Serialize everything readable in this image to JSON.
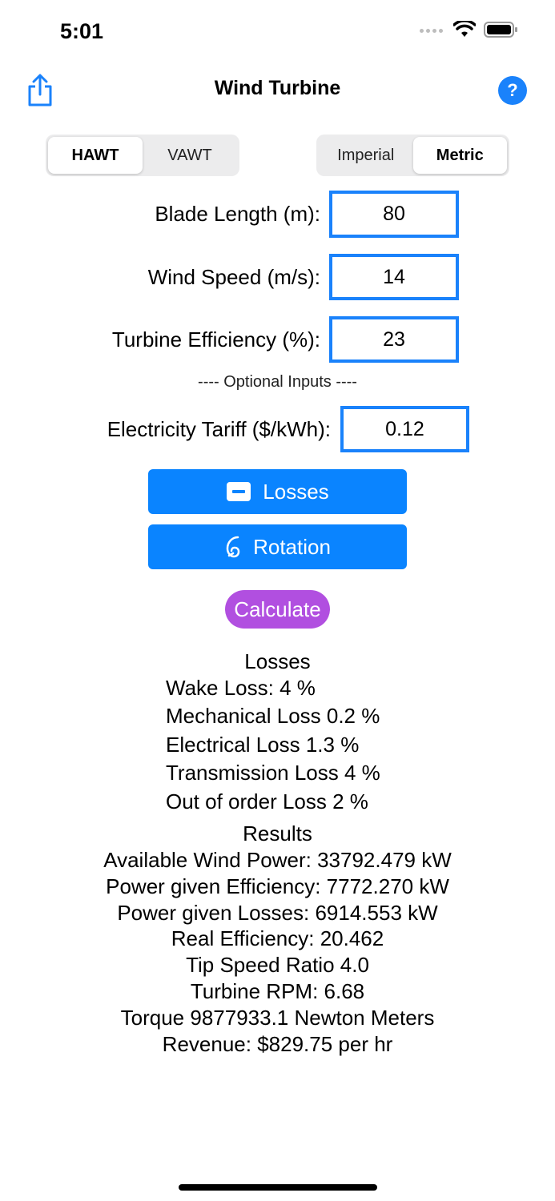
{
  "status_bar": {
    "time": "5:01"
  },
  "nav": {
    "title": "Wind Turbine",
    "help_label": "?"
  },
  "turbine_type": {
    "options": [
      "HAWT",
      "VAWT"
    ],
    "selected": "HAWT"
  },
  "unit_system": {
    "options": [
      "Imperial",
      "Metric"
    ],
    "selected": "Metric"
  },
  "inputs": {
    "blade_length": {
      "label": "Blade Length (m):",
      "value": "80"
    },
    "wind_speed": {
      "label": "Wind Speed (m/s):",
      "value": "14"
    },
    "efficiency": {
      "label": "Turbine Efficiency (%):",
      "value": "23"
    }
  },
  "optional_header": "---- Optional Inputs ----",
  "tariff": {
    "label": "Electricity Tariff ($/kWh):",
    "value": "0.12"
  },
  "buttons": {
    "losses": "Losses",
    "rotation": "Rotation",
    "calculate": "Calculate"
  },
  "losses": {
    "heading": "Losses",
    "items": [
      "Wake Loss: 4 %",
      "Mechanical Loss 0.2 %",
      "Electrical Loss 1.3 %",
      "Transmission Loss 4 %",
      "Out of order Loss 2 %"
    ]
  },
  "results": {
    "heading": "Results",
    "items": [
      "Available Wind Power: 33792.479 kW",
      "Power given Efficiency: 7772.270 kW",
      "Power given Losses: 6914.553 kW",
      "Real Efficiency: 20.462",
      "Tip Speed Ratio 4.0",
      "Turbine RPM: 6.68",
      "Torque 9877933.1 Newton Meters",
      "Revenue: $829.75 per hr"
    ]
  },
  "colors": {
    "accent": "#0a84ff",
    "calculate": "#b14fe0"
  }
}
